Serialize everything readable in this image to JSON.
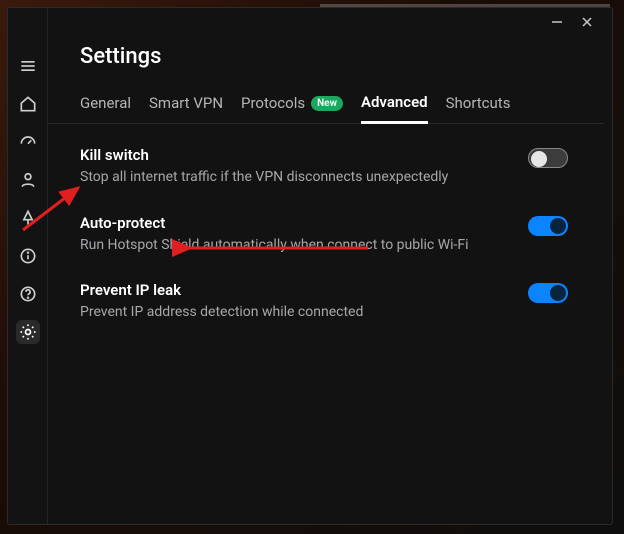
{
  "window": {
    "minimize_icon": "minimize",
    "close_icon": "close"
  },
  "page": {
    "title": "Settings"
  },
  "tabs": [
    {
      "id": "general",
      "label": "General",
      "active": false,
      "badge": null
    },
    {
      "id": "smartvpn",
      "label": "Smart VPN",
      "active": false,
      "badge": null
    },
    {
      "id": "protocols",
      "label": "Protocols",
      "active": false,
      "badge": "New"
    },
    {
      "id": "advanced",
      "label": "Advanced",
      "active": true,
      "badge": null
    },
    {
      "id": "shortcuts",
      "label": "Shortcuts",
      "active": false,
      "badge": null
    }
  ],
  "options": [
    {
      "id": "kill-switch",
      "label": "Kill switch",
      "description": "Stop all internet traffic if the VPN disconnects unexpectedly",
      "value": false
    },
    {
      "id": "auto-protect",
      "label": "Auto-protect",
      "description": "Run Hotspot Shield automatically when connect to public Wi-Fi",
      "value": true
    },
    {
      "id": "prevent-ip-leak",
      "label": "Prevent IP leak",
      "description": "Prevent IP address detection while connected",
      "value": true
    }
  ],
  "sidebar": {
    "items": [
      {
        "id": "menu",
        "icon": "menu-icon"
      },
      {
        "id": "home",
        "icon": "home-icon"
      },
      {
        "id": "speed",
        "icon": "speed-icon"
      },
      {
        "id": "account",
        "icon": "person-icon"
      },
      {
        "id": "activity",
        "icon": "activity-icon"
      },
      {
        "id": "info",
        "icon": "info-icon"
      },
      {
        "id": "help",
        "icon": "help-icon"
      },
      {
        "id": "settings",
        "icon": "gear-icon",
        "active": true
      }
    ]
  },
  "colors": {
    "accent": "#0a84ff",
    "badge": "#1aa760",
    "annotation": "#e02020"
  }
}
